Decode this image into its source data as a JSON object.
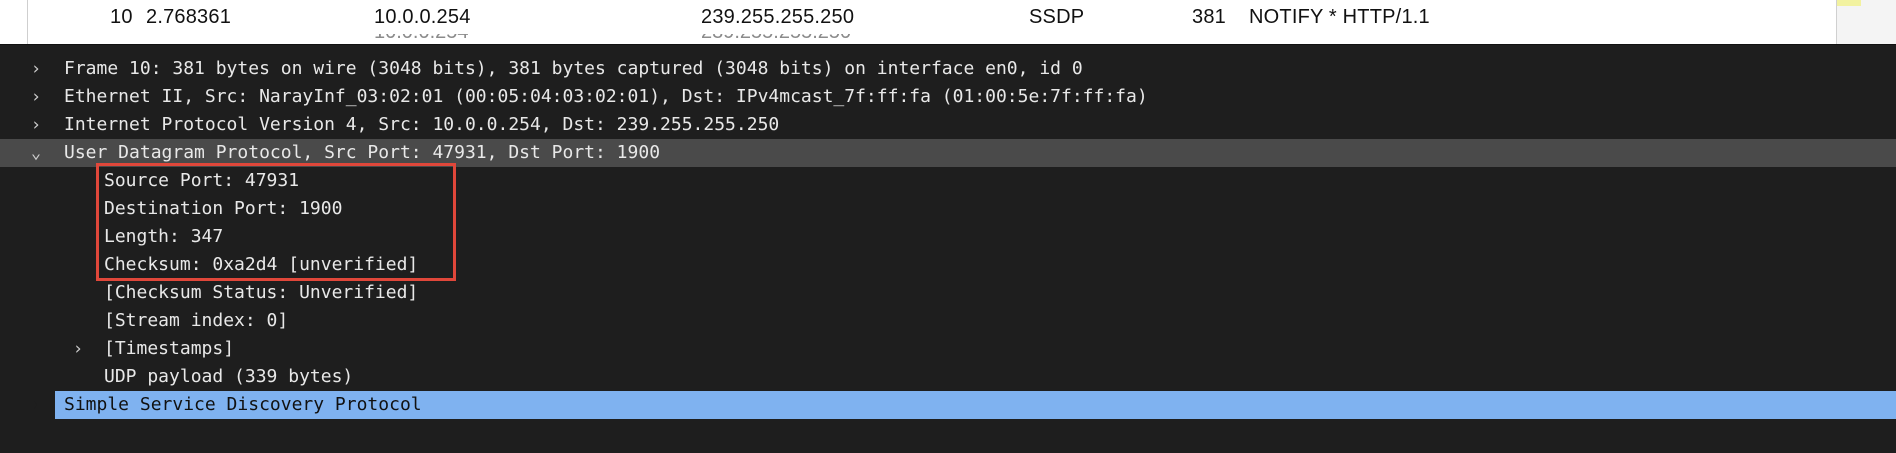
{
  "packet_list": {
    "selected_row": {
      "number": "10",
      "time": "2.768361",
      "source": "10.0.0.254",
      "destination": "239.255.255.250",
      "protocol": "SSDP",
      "length": "381",
      "info": "NOTIFY * HTTP/1.1"
    },
    "next_row_partial": {
      "source": "10.0.0.254",
      "destination": "239.255.255.250"
    }
  },
  "details": {
    "frame": "Frame 10: 381 bytes on wire (3048 bits), 381 bytes captured (3048 bits) on interface en0, id 0",
    "ethernet": "Ethernet II, Src: NarayInf_03:02:01 (00:05:04:03:02:01), Dst: IPv4mcast_7f:ff:fa (01:00:5e:7f:ff:fa)",
    "ip": "Internet Protocol Version 4, Src: 10.0.0.254, Dst: 239.255.255.250",
    "udp": "User Datagram Protocol, Src Port: 47931, Dst Port: 1900",
    "udp_fields": [
      "Source Port: 47931",
      "Destination Port: 1900",
      "Length: 347",
      "Checksum: 0xa2d4 [unverified]",
      "[Checksum Status: Unverified]",
      "[Stream index: 0]",
      "[Timestamps]",
      "UDP payload (339 bytes)"
    ],
    "ssdp": "Simple Service Discovery Protocol"
  },
  "icons": {
    "collapsed": "chevron-right-icon",
    "expanded": "chevron-down-icon"
  },
  "colors": {
    "selected_row": "#7fb2f0",
    "expanded_row": "#4a4a4a",
    "annotation_box": "#e0473a"
  }
}
